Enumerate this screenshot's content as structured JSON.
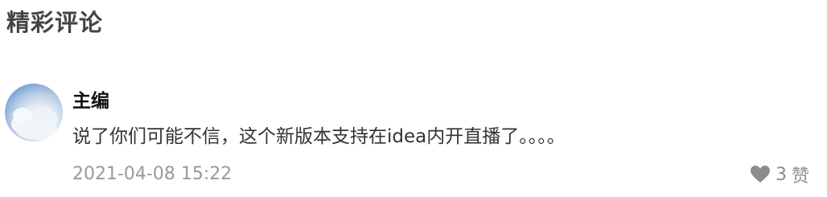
{
  "section": {
    "title": "精彩评论"
  },
  "comment": {
    "author": "主编",
    "text": "说了你们可能不信，这个新版本支持在idea内开直播了。。。。",
    "timestamp": "2021-04-08 15:22",
    "likes": "3",
    "like_label": "赞",
    "like_icon": "heart-icon",
    "avatar_icon": "avatar-cloud-icon"
  },
  "colors": {
    "title": "#444444",
    "author": "#111111",
    "text": "#333333",
    "meta": "#9a9a9a",
    "like": "#8c8c8c"
  }
}
